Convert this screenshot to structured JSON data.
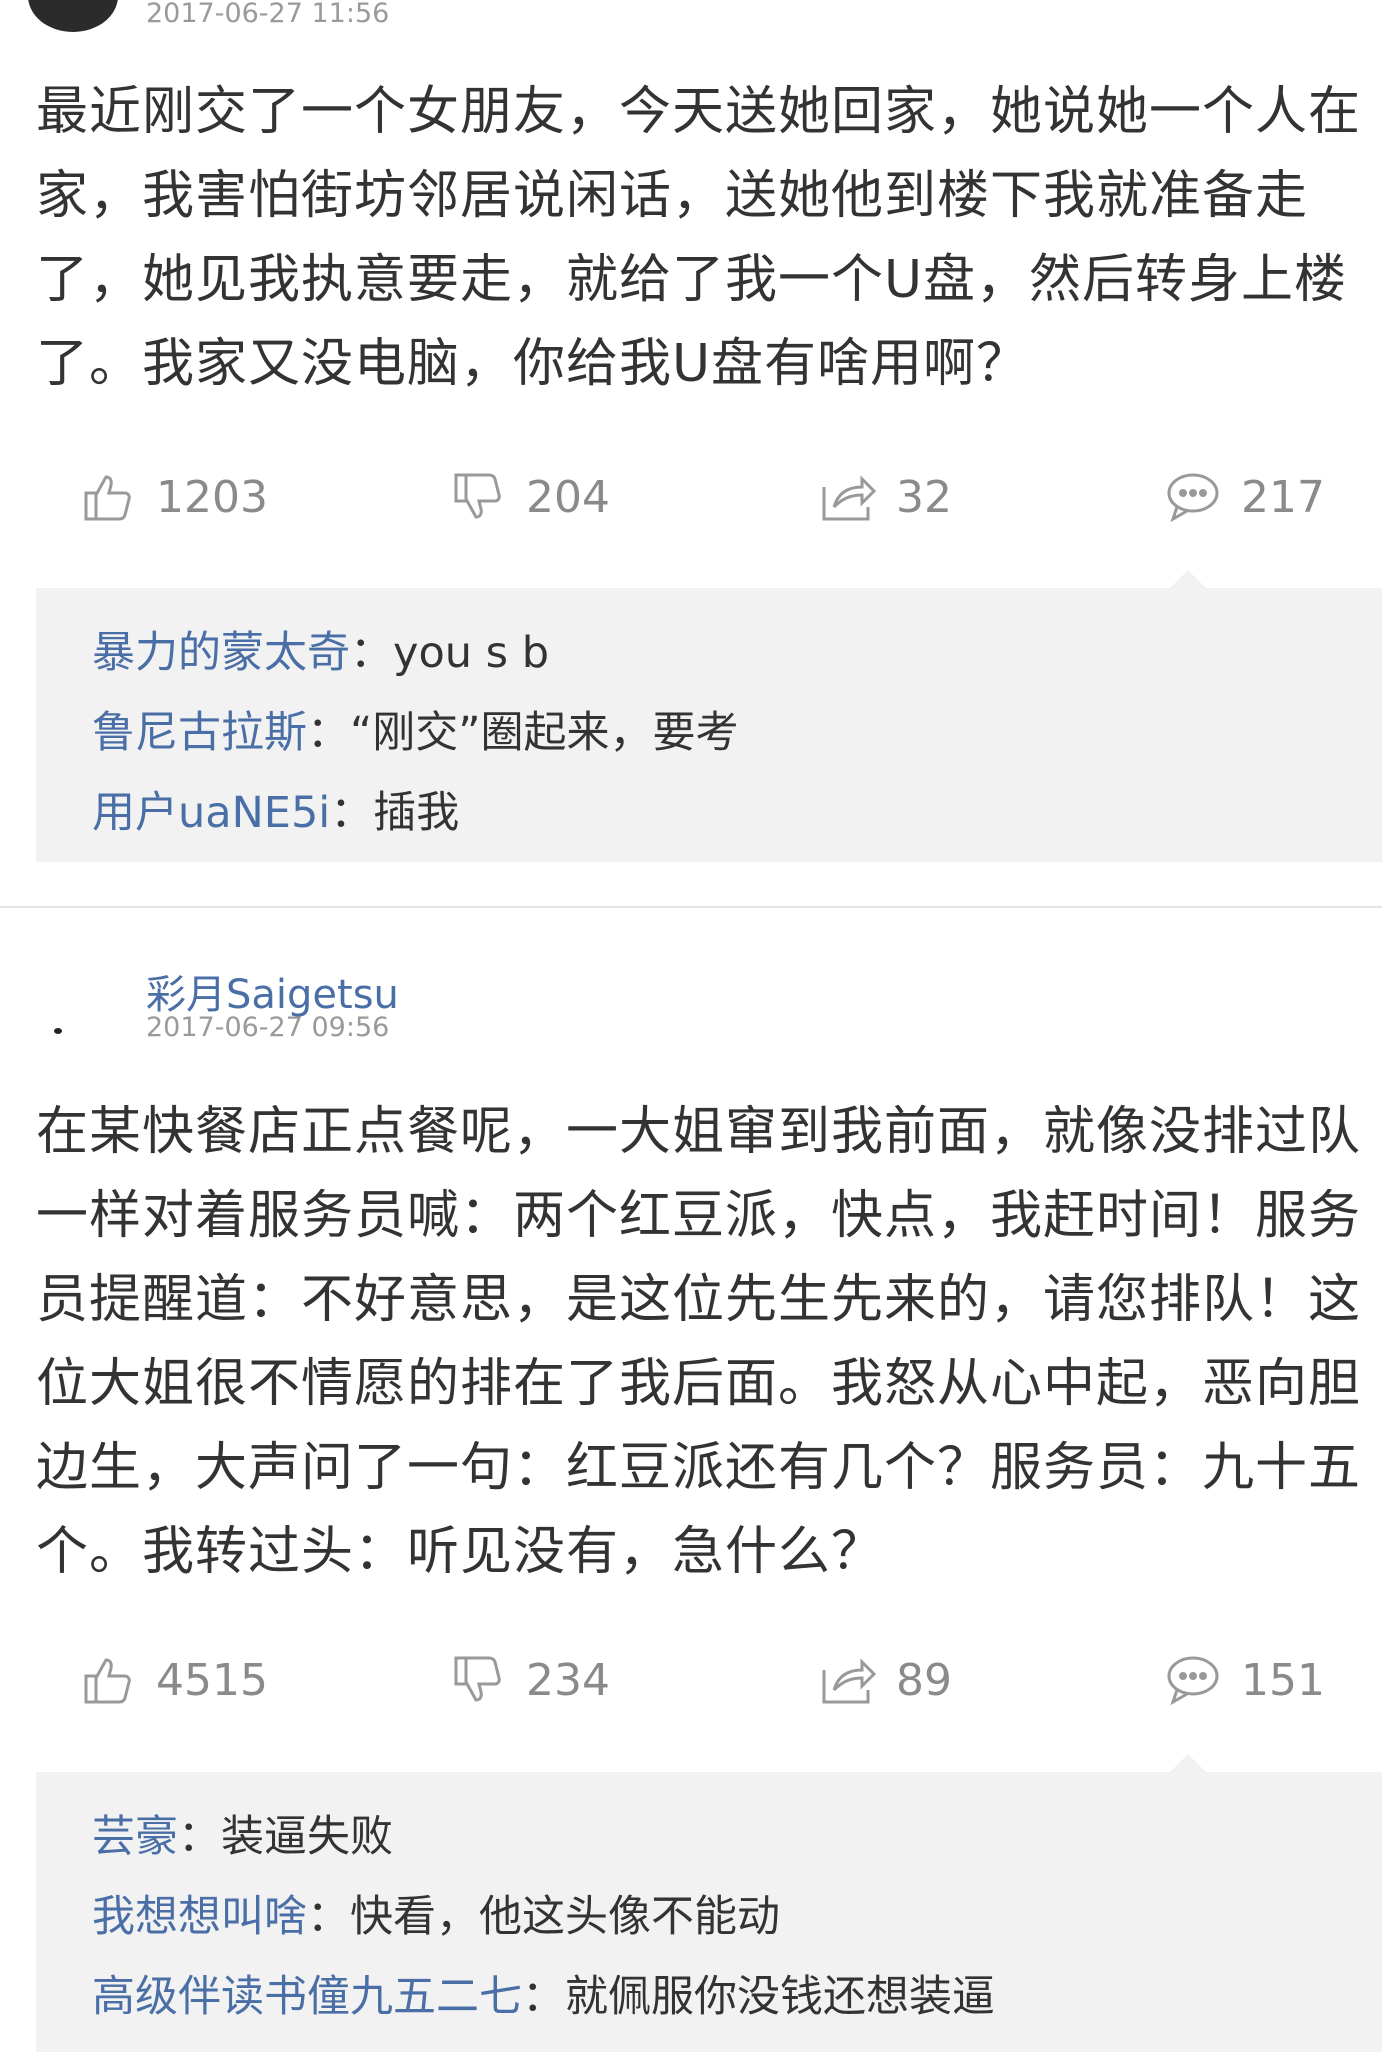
{
  "post1": {
    "timestamp": "2017-06-27 11:56",
    "text": "最近刚交了一个女朋友，今天送她回家，她说她一个人在家，我害怕街坊邻居说闲话，送她他到楼下我就准备走了，她见我执意要走，就给了我一个U盘，然后转身上楼了。我家又没电脑，你给我U盘有啥用啊？",
    "likes": "1203",
    "dislikes": "204",
    "shares": "32",
    "comments": "217",
    "replies": [
      {
        "name": "暴力的蒙太奇",
        "text": "：you s b"
      },
      {
        "name": "鲁尼古拉斯",
        "text": "：“刚交”圈起来，要考"
      },
      {
        "name": "用户uaNE5i",
        "text": "：插我"
      }
    ]
  },
  "post2": {
    "username": "彩月Saigetsu",
    "timestamp": "2017-06-27 09:56",
    "text": "在某快餐店正点餐呢，一大姐窜到我前面，就像没排过队一样对着服务员喊：两个红豆派，快点，我赶时间！服务员提醒道：不好意思，是这位先生先来的，请您排队！这位大姐很不情愿的排在了我后面。我怒从心中起，恶向胆边生，大声问了一句：红豆派还有几个？服务员：九十五个。我转过头：听见没有，急什么？",
    "likes": "4515",
    "dislikes": "234",
    "shares": "89",
    "comments": "151",
    "replies": [
      {
        "name": "芸豪",
        "text": "：装逼失败"
      },
      {
        "name": "我想想叫啥",
        "text": "：快看，他这头像不能动"
      },
      {
        "name": "高级伴读书僮九五二七",
        "text": "：就佩服你没钱还想装逼"
      }
    ]
  },
  "colors": {
    "link": "#4a6ea6",
    "meta": "#9a9a9a",
    "reply_bg": "#f2f2f2"
  },
  "icons": [
    "thumbs-up-icon",
    "thumbs-down-icon",
    "share-icon",
    "comment-icon"
  ]
}
